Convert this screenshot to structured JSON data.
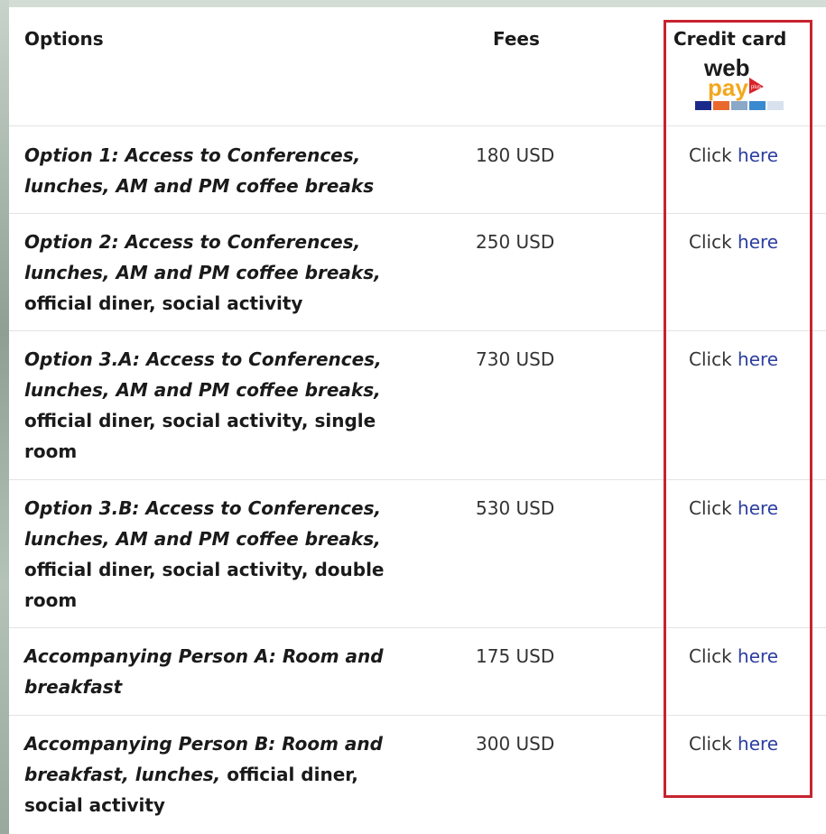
{
  "header": {
    "options": "Options",
    "fees": "Fees",
    "credit_card": "Credit card",
    "logo_text_web": "web",
    "logo_text_pay": "pay",
    "logo_text_plus": "plus"
  },
  "click_label": "Click",
  "link_label": "here",
  "rows": [
    {
      "italic": "Option 1: Access to Conferences, lunches, AM and PM coffee breaks",
      "plain": "",
      "fee": "180 USD"
    },
    {
      "italic": "Option  2: Access to Conferences, lunches, AM and PM coffee breaks,",
      "plain": " official diner, social activity",
      "fee": "250 USD"
    },
    {
      "italic": "Option 3.A: Access to Conferences, lunches, AM and PM coffee breaks,",
      "plain": " official diner, social activity, single room",
      "fee": "730 USD"
    },
    {
      "italic": "Option 3.B: Access to Conferences, lunches, AM and PM coffee breaks,",
      "plain": " official diner, social activity, double room",
      "fee": "530 USD"
    },
    {
      "italic": "Accompanying Person A: Room and breakfast",
      "plain": "",
      "fee": "175 USD"
    },
    {
      "italic": "Accompanying Person B: Room and breakfast, lunches,",
      "plain": " official diner, social activity",
      "fee": "300 USD"
    }
  ],
  "colors": {
    "link": "#2c3ea0",
    "highlight_border": "#c7232f"
  }
}
